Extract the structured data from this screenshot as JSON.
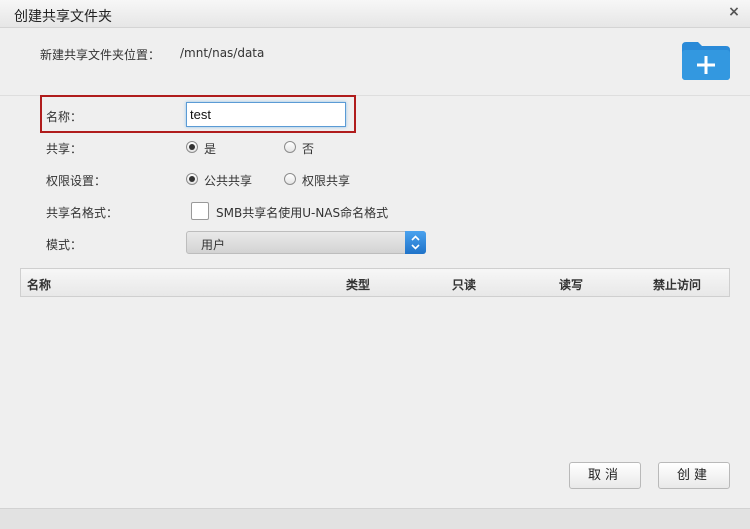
{
  "window": {
    "title": "创建共享文件夹",
    "close_symbol": "×"
  },
  "location": {
    "label": "新建共享文件夹位置：",
    "value": "/mnt/nas/data"
  },
  "form": {
    "name_label": "名称：",
    "name_value": "test",
    "share_label": "共享：",
    "share_yes": "是",
    "share_no": "否",
    "share_selected": "是",
    "perm_label": "权限设置：",
    "perm_public": "公共共享",
    "perm_restricted": "权限共享",
    "perm_selected": "公共共享",
    "format_label": "共享名格式：",
    "format_checkbox_label": "SMB共享名使用U-NAS命名格式",
    "format_checked": false,
    "mode_label": "模式：",
    "mode_value": "用户"
  },
  "table": {
    "columns": [
      "名称",
      "类型",
      "只读",
      "读写",
      "禁止访问"
    ],
    "rows": []
  },
  "buttons": {
    "cancel": "取消",
    "create": "创建"
  },
  "colors": {
    "highlight_border": "#b01c1c",
    "accent_blue": "#2a8ad8"
  },
  "icons": {
    "folder_add": "folder-add-icon"
  }
}
